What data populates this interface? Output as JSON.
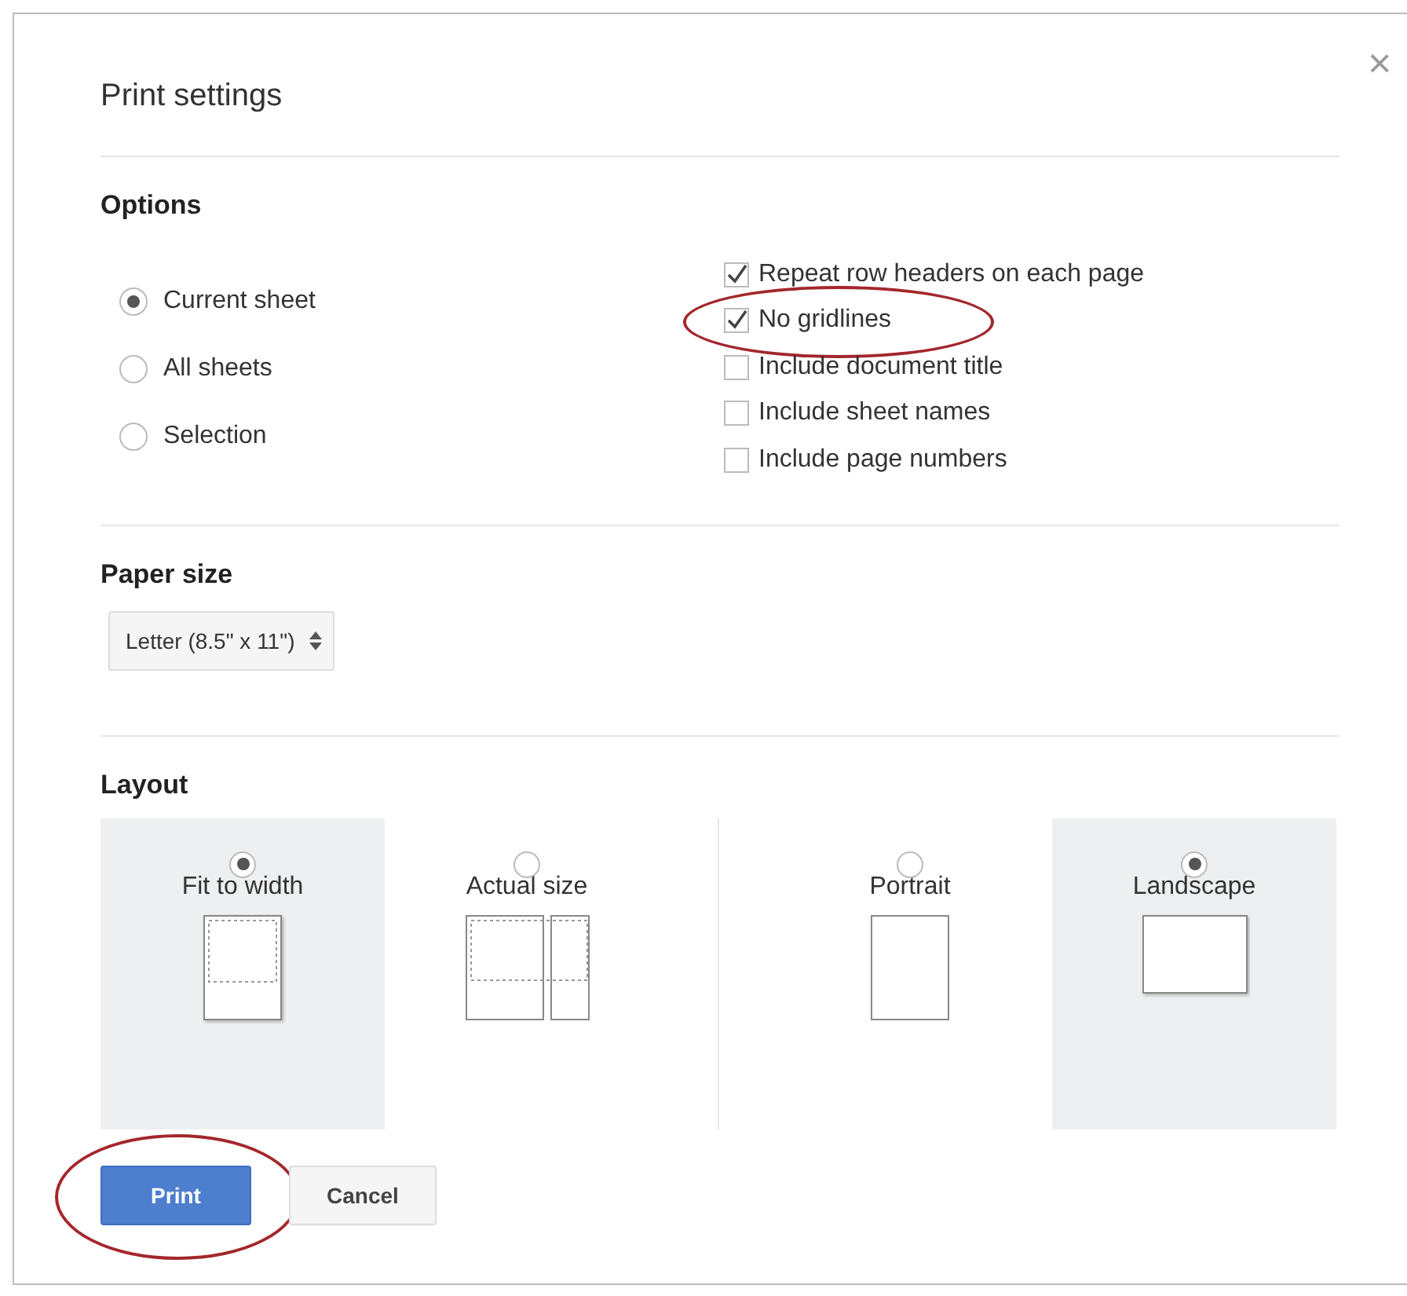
{
  "dialog": {
    "title": "Print settings",
    "close": "×"
  },
  "options": {
    "heading": "Options",
    "ranges": [
      {
        "label": "Current sheet",
        "selected": true
      },
      {
        "label": "All sheets",
        "selected": false
      },
      {
        "label": "Selection",
        "selected": false
      }
    ],
    "checkboxes": [
      {
        "label": "Repeat row headers on each page",
        "checked": true,
        "circled": false
      },
      {
        "label": "No gridlines",
        "checked": true,
        "circled": true
      },
      {
        "label": "Include document title",
        "checked": false,
        "circled": false
      },
      {
        "label": "Include sheet names",
        "checked": false,
        "circled": false
      },
      {
        "label": "Include page numbers",
        "checked": false,
        "circled": false
      }
    ]
  },
  "paper_size": {
    "heading": "Paper size",
    "value": "Letter (8.5\" x 11\")"
  },
  "layout": {
    "heading": "Layout",
    "scale": [
      {
        "label": "Fit to width",
        "kind": "fit",
        "selected": true
      },
      {
        "label": "Actual size",
        "kind": "actual",
        "selected": false
      }
    ],
    "orientation": [
      {
        "label": "Portrait",
        "kind": "portrait",
        "selected": false
      },
      {
        "label": "Landscape",
        "kind": "landscape",
        "selected": true
      }
    ]
  },
  "buttons": [
    {
      "label": "Print",
      "kind": "primary",
      "circled": true
    },
    {
      "label": "Cancel",
      "kind": "secondary",
      "circled": false
    }
  ]
}
